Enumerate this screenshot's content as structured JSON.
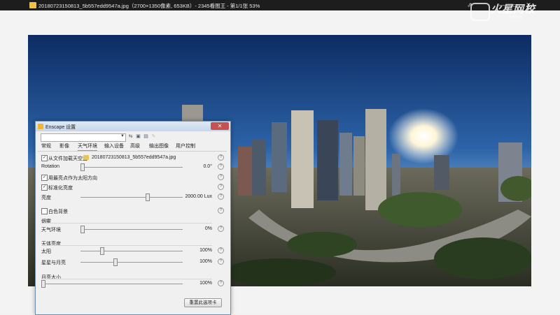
{
  "viewer": {
    "title": "20180723150813_5b557edd9547a.jpg（2700×1350像素, 653KB）- 2345看图王 - 第1/1张 53%",
    "watermark_title": "火星网校",
    "watermark_url": "hxsd.tv",
    "controls": [
      "⇗",
      "—",
      "▭",
      "✕"
    ]
  },
  "dialog": {
    "title": "Enscape 设置",
    "tabs": [
      "常规",
      "影像",
      "天气环境",
      "输入设备",
      "高级",
      "输出图像",
      "用户控制"
    ],
    "active_tab": "天气环境",
    "load_sky_label": "从文件加载天空盒",
    "load_sky_checked": "✓",
    "sky_file": "20180723150813_5b557edd9547a.jpg",
    "rotation_label": "Rotation",
    "rotation_value": "0.0°",
    "rotation_level": 0,
    "sun_dir_label": "用最亮点作为太阳方向",
    "sun_dir_checked": "✓",
    "normalize_label": "标准化亮度",
    "normalize_checked": "✓",
    "brightness_label": "亮度",
    "brightness_value": "2000.00 Lux",
    "brightness_level": 0.66,
    "white_bg_label": "白色背景",
    "fog_header": "烟雾",
    "env_label": "天气环境",
    "env_value": "0%",
    "env_level": 0,
    "sky_header": "天体亮度",
    "sun_label": "太阳",
    "sun_value": "100%",
    "sun_level": 0.2,
    "stars_label": "星星与月亮",
    "stars_value": "100%",
    "stars_level": 0.33,
    "moon_header": "月亮大小",
    "moon_value": "100%",
    "moon_level": 0,
    "reset_label": "重置此选项卡",
    "help_glyph": "?"
  }
}
